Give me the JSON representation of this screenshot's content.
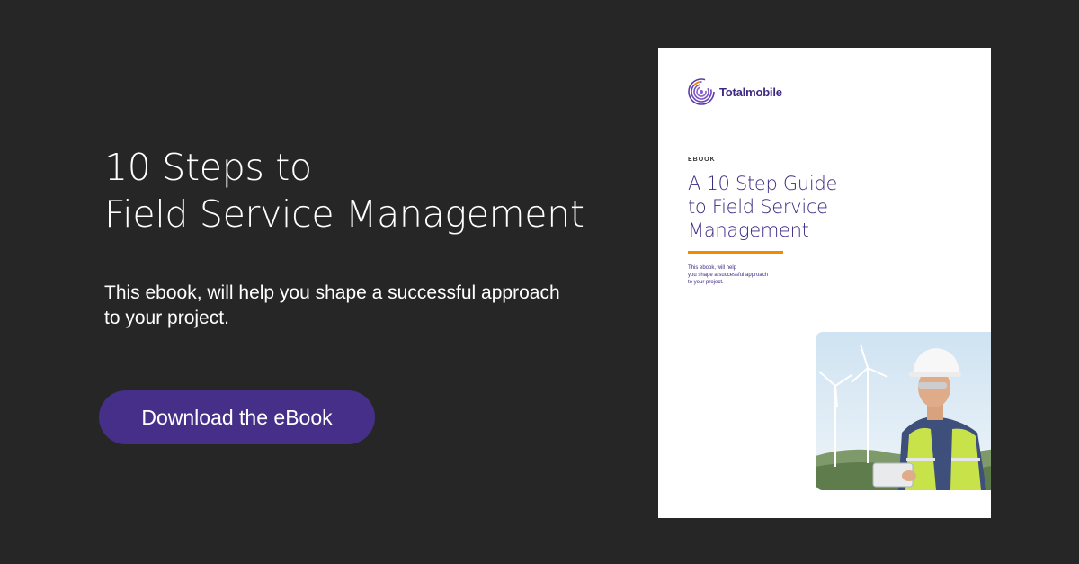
{
  "headline": {
    "line1": "10 Steps to",
    "line2": "Field Service Management"
  },
  "subtext": {
    "line1": "This ebook, will help you shape a successful approach",
    "line2": "to your project."
  },
  "cta": {
    "label": "Download the eBook"
  },
  "cover": {
    "brand": "Totalmobile",
    "eyebrow": "EBOOK",
    "title": {
      "line1": "A 10 Step Guide",
      "line2": "to Field Service",
      "line3": "Management"
    },
    "blurb": {
      "line1": "This ebook, will help",
      "line2": "you shape a successful approach",
      "line3": "to your project."
    },
    "photo_icon": "field-worker-with-tablet-photo"
  },
  "colors": {
    "background": "#262626",
    "brand_purple": "#452f89",
    "accent_orange": "#f08a00",
    "text_white": "#ffffff"
  }
}
